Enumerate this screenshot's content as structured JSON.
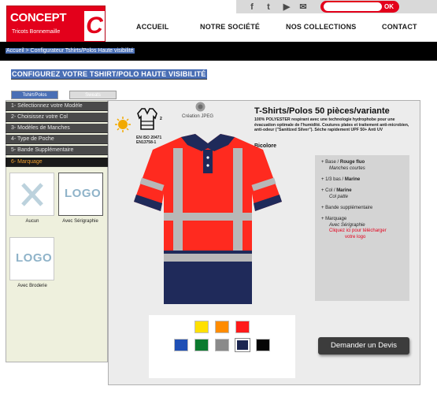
{
  "topbar": {
    "social": [
      {
        "name": "facebook-icon",
        "glyph": "f"
      },
      {
        "name": "twitter-icon",
        "glyph": "t"
      },
      {
        "name": "youtube-icon",
        "glyph": "▶"
      },
      {
        "name": "email-icon",
        "glyph": "✉"
      }
    ],
    "search_placeholder": "",
    "ok_label": "OK"
  },
  "logo": {
    "word": "CONCEPT",
    "sub": "Tricots Bonnemaille",
    "letter": "C"
  },
  "nav": {
    "items": [
      "ACCUEIL",
      "NOTRE SOCIÉTÉ",
      "NOS COLLECTIONS",
      "CONTACT"
    ]
  },
  "breadcrumb": "Accueil  >  Configurateur Tshirts/Polos Haute visibilité",
  "page_title": "CONFIGUREZ VOTRE TSHIRT/POLO HAUTE VISIBILITÉ",
  "tabs": [
    {
      "label": "Tshirt/Polos",
      "active": true
    },
    {
      "label": "Sweats",
      "active": false
    }
  ],
  "steps": [
    {
      "label": "1- Sélectionnez votre Modèle",
      "active": false
    },
    {
      "label": "2- Choisissez votre Col",
      "active": false
    },
    {
      "label": "3- Modèles de Manches",
      "active": false
    },
    {
      "label": "4- Type de Poche",
      "active": false
    },
    {
      "label": "5- Bande Supplémentaire",
      "active": false
    },
    {
      "label": "6- Marquage",
      "active": true
    }
  ],
  "marquage_options": [
    {
      "label": "Aucun"
    },
    {
      "label": "Avec Sérigraphie",
      "thumb_text": "LOGO"
    },
    {
      "label": "Avec Broderie",
      "thumb_text": "LOGO"
    }
  ],
  "product": {
    "title": "T-Shirts/Polos 50 pièces/variante",
    "description": "100% POLYESTER respirant avec une technologie hydrophobe pour une évacuation optimale de l'humidité. Coutures plates et traitement anti-microbien, anti-odeur (\"Sanitized Silver\"). Séche rapidement UPF 50+ Anti UV",
    "variant": "Bicolore",
    "cert_number": "2",
    "cert_text": [
      "EN ISO 20471",
      "EN13758-1"
    ],
    "creation_label": "Création JPEG"
  },
  "attributes": [
    {
      "line1_prefix": "+ Base / ",
      "line1_bold": "Rouge fluo",
      "line2": "Manches courtes"
    },
    {
      "line1_prefix": "+ 1/3 bas / ",
      "line1_bold": "Marine",
      "line2": ""
    },
    {
      "line1_prefix": "+ Col / ",
      "line1_bold": "Marine",
      "line2": "Col patte"
    },
    {
      "line1_prefix": "+ Bande supplémentaire",
      "line1_bold": "",
      "line2": ""
    },
    {
      "line1_prefix": "+ Marquage",
      "line1_bold": "",
      "line2": "Avec Sérigraphie",
      "line3": "Cliquez ici pour télécharger",
      "line4": "votre logo"
    }
  ],
  "swatches": {
    "row1": [
      "#ffe000",
      "#ff8c00",
      "#ff1a1a"
    ],
    "row2": [
      "#1f4fb5",
      "#0b7a2e",
      "#8a8a8a",
      "#1b2550",
      "#050505"
    ]
  },
  "devis_label": "Demander un Devis"
}
